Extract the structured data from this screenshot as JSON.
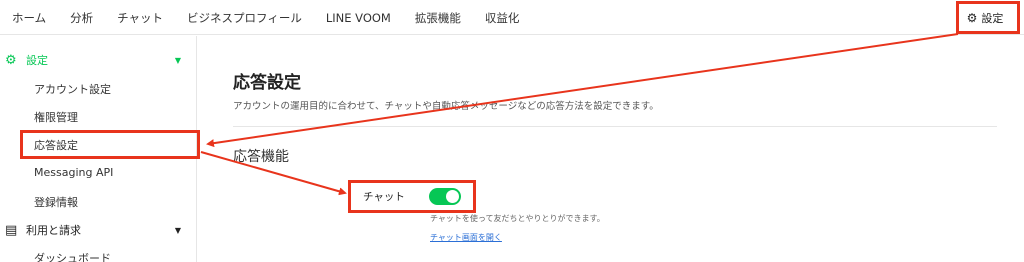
{
  "topnav": {
    "items": [
      "ホーム",
      "分析",
      "チャット",
      "ビジネスプロフィール",
      "LINE VOOM",
      "拡張機能",
      "収益化"
    ],
    "settings_label": "設定"
  },
  "sidebar": {
    "settings_group": "設定",
    "settings_items": [
      "アカウント設定",
      "権限管理",
      "応答設定",
      "Messaging API",
      "登録情報"
    ],
    "billing_group": "利用と請求",
    "billing_items": [
      "ダッシュボード"
    ]
  },
  "main": {
    "title": "応答設定",
    "description": "アカウントの運用目的に合わせて、チャットや自動応答メッセージなどの応答方法を設定できます。",
    "section_title": "応答機能",
    "chat_label": "チャット",
    "chat_enabled": true,
    "chat_help": "チャットを使って友だちとやりとりができます。",
    "chat_link": "チャット画面を開く"
  },
  "colors": {
    "accent_green": "#06c755",
    "annotation_red": "#e8341c",
    "link_blue": "#2b6fd6"
  }
}
